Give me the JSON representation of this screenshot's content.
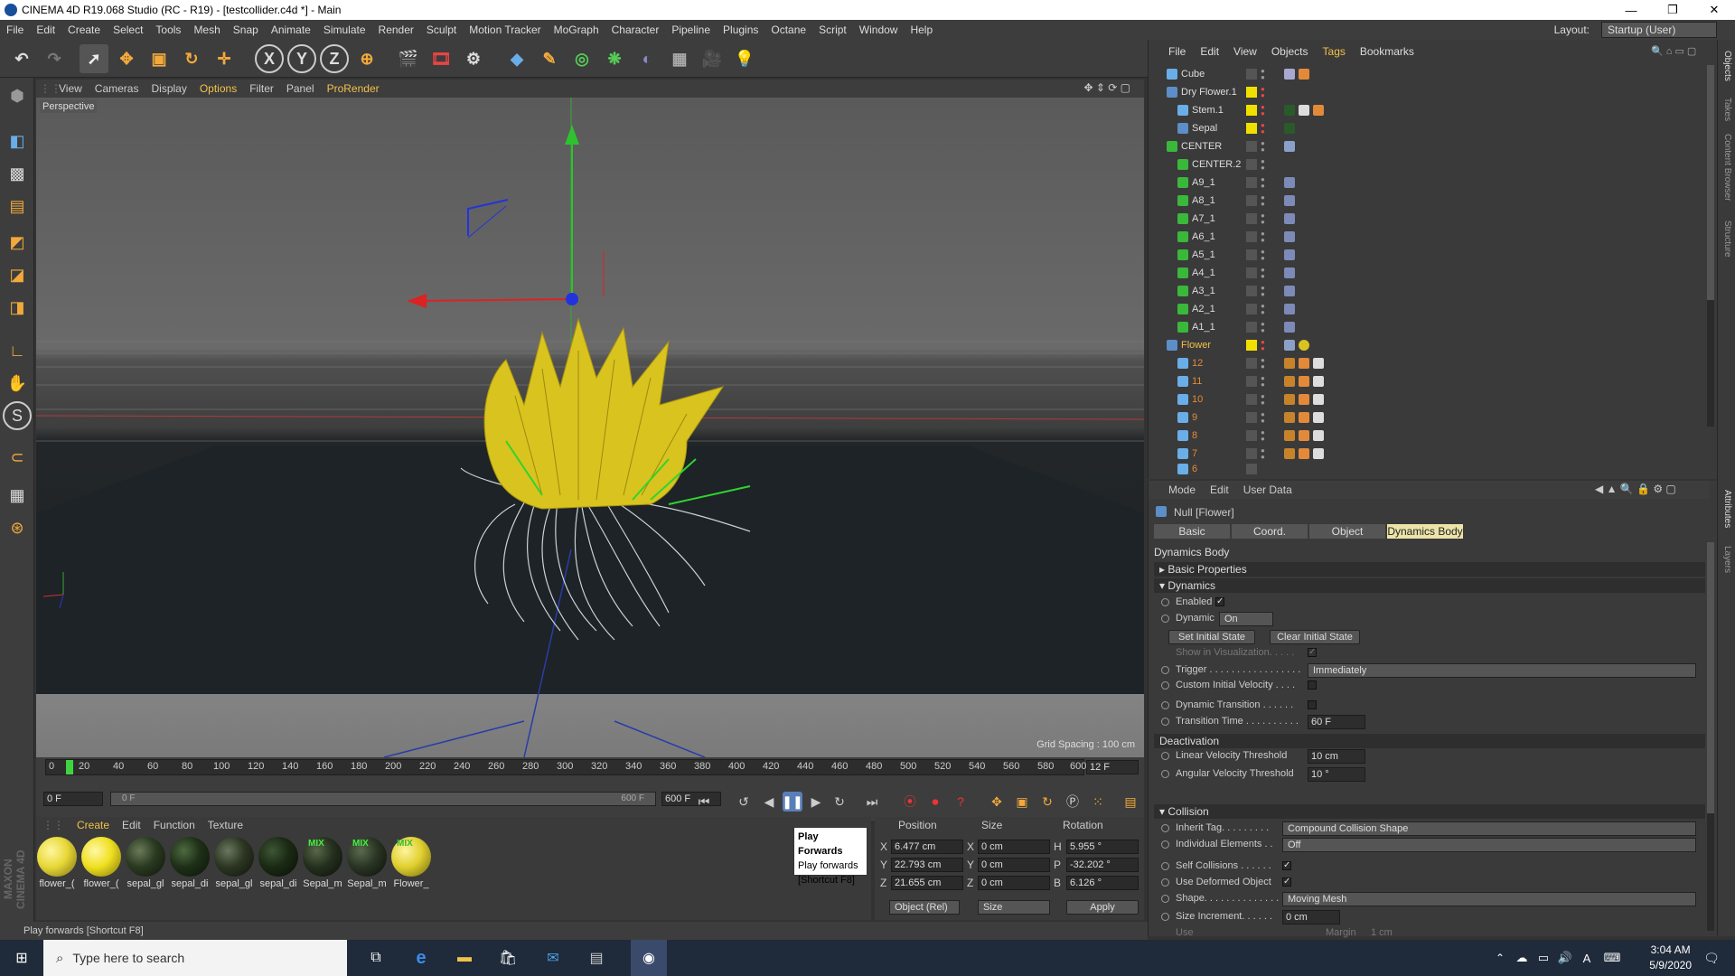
{
  "window": {
    "title": "CINEMA 4D R19.068 Studio (RC - R19) - [testcollider.c4d *] - Main",
    "min": "—",
    "max": "❐",
    "close": "✕"
  },
  "menu": [
    "File",
    "Edit",
    "Create",
    "Select",
    "Tools",
    "Mesh",
    "Snap",
    "Animate",
    "Simulate",
    "Render",
    "Sculpt",
    "Motion Tracker",
    "MoGraph",
    "Character",
    "Pipeline",
    "Plugins",
    "Octane",
    "Script",
    "Window",
    "Help"
  ],
  "layout": {
    "label": "Layout:",
    "value": "Startup (User)"
  },
  "viewport": {
    "menu": [
      "View",
      "Cameras",
      "Display",
      "Options",
      "Filter",
      "Panel",
      "ProRender"
    ],
    "label": "Perspective",
    "grid_spacing": "Grid Spacing : 100 cm"
  },
  "timeline": {
    "ticks": [
      "0",
      "20",
      "40",
      "60",
      "80",
      "100",
      "120",
      "140",
      "160",
      "180",
      "200",
      "220",
      "240",
      "260",
      "280",
      "300",
      "320",
      "340",
      "360",
      "380",
      "400",
      "420",
      "440",
      "460",
      "480",
      "500",
      "520",
      "540",
      "560",
      "580",
      "600"
    ],
    "current": "12 F",
    "start": "0 F",
    "range_start": "0 F",
    "range_end": "600 F",
    "end": "600 F"
  },
  "materials": {
    "menu": [
      "Create",
      "Edit",
      "Function",
      "Texture"
    ],
    "items": [
      {
        "name": "flower_(",
        "color": "#e8d838"
      },
      {
        "name": "flower_(",
        "color": "#f0e020"
      },
      {
        "name": "sepal_gl",
        "color": "#2a3a20"
      },
      {
        "name": "sepal_di",
        "color": "#1e3018"
      },
      {
        "name": "sepal_gl",
        "color": "#2c3622"
      },
      {
        "name": "sepal_di",
        "color": "#1a2a14"
      },
      {
        "name": "Sepal_m",
        "color": "#25301e",
        "mix": "MIX"
      },
      {
        "name": "Sepal_m",
        "color": "#2a3524",
        "mix": "MIX"
      },
      {
        "name": "Flower_",
        "color": "#e0d030",
        "mix": "MIX"
      }
    ]
  },
  "coords": {
    "headers": [
      "Position",
      "Size",
      "Rotation"
    ],
    "rows": [
      {
        "a": "X",
        "pos": "6.477 cm",
        "b": "X",
        "size": "0 cm",
        "c": "H",
        "rot": "5.955 °"
      },
      {
        "a": "Y",
        "pos": "22.793 cm",
        "b": "Y",
        "size": "0 cm",
        "c": "P",
        "rot": "-32.202 °"
      },
      {
        "a": "Z",
        "pos": "21.655 cm",
        "b": "Z",
        "size": "0 cm",
        "c": "B",
        "rot": "6.126 °"
      }
    ],
    "mode": "Object (Rel)",
    "size_mode": "Size",
    "apply": "Apply"
  },
  "tooltip": [
    "Play Forwards",
    "Play forwards",
    "[Shortcut F8]"
  ],
  "status": "Play forwards [Shortcut F8]",
  "objects": {
    "menu": [
      "File",
      "Edit",
      "View",
      "Objects",
      "Tags",
      "Bookmarks"
    ],
    "rows": [
      {
        "name": "Cube",
        "indent": 0
      },
      {
        "name": "Dry Flower.1",
        "indent": 0
      },
      {
        "name": "Stem.1",
        "indent": 1
      },
      {
        "name": "Sepal",
        "indent": 1
      },
      {
        "name": "CENTER",
        "indent": 0
      },
      {
        "name": "CENTER.2",
        "indent": 1
      },
      {
        "name": "A9_1",
        "indent": 1
      },
      {
        "name": "A8_1",
        "indent": 1
      },
      {
        "name": "A7_1",
        "indent": 1
      },
      {
        "name": "A6_1",
        "indent": 1
      },
      {
        "name": "A5_1",
        "indent": 1
      },
      {
        "name": "A4_1",
        "indent": 1
      },
      {
        "name": "A3_1",
        "indent": 1
      },
      {
        "name": "A2_1",
        "indent": 1
      },
      {
        "name": "A1_1",
        "indent": 1
      },
      {
        "name": "Flower",
        "indent": 0
      },
      {
        "name": "12",
        "indent": 1
      },
      {
        "name": "11",
        "indent": 1
      },
      {
        "name": "10",
        "indent": 1
      },
      {
        "name": "9",
        "indent": 1
      },
      {
        "name": "8",
        "indent": 1
      },
      {
        "name": "7",
        "indent": 1
      },
      {
        "name": "6",
        "indent": 1
      }
    ]
  },
  "attributes": {
    "menu": [
      "Mode",
      "Edit",
      "User Data"
    ],
    "object": "Null [Flower]",
    "tabs": [
      "Basic",
      "Coord.",
      "Object",
      "Dynamics Body"
    ],
    "heading": "Dynamics Body",
    "basic_props": "Basic Properties",
    "dynamics": "Dynamics",
    "enabled": "Enabled",
    "dynamic": "Dynamic",
    "dynamic_value": "On",
    "set_initial": "Set Initial State",
    "clear_initial": "Clear Initial State",
    "show_vis": "Show in Visualization. . . . .",
    "trigger": "Trigger . . . . . . . . . . . . . . . . .",
    "trigger_value": "Immediately",
    "custom_vel": "Custom Initial Velocity . . . .",
    "dyn_trans": "Dynamic Transition . . . . . .",
    "trans_time": "Transition Time . . . . . . . . . .",
    "trans_time_value": "60 F",
    "deactivation": "Deactivation",
    "lin_vel": "Linear Velocity Threshold",
    "lin_vel_value": "10 cm",
    "ang_vel": "Angular Velocity Threshold",
    "ang_vel_value": "10 °",
    "collision": "Collision",
    "inherit": "Inherit Tag. . . . . . . . .",
    "inherit_value": "Compound Collision Shape",
    "indiv": "Individual Elements . .",
    "indiv_value": "Off",
    "self_col": "Self Collisions . . . . . .",
    "deformed": "Use Deformed Object",
    "shape": "Shape. . . . . . . . . . . . . .",
    "shape_value": "Moving Mesh",
    "size_inc": "Size Increment. . . . . .",
    "size_inc_value": "0 cm",
    "use": "Use",
    "margin": "Margin",
    "margin_value": "1 cm"
  },
  "right_tabs": [
    "Objects",
    "Takes",
    "Content Browser",
    "Structure",
    "Attributes",
    "Layers"
  ],
  "taskbar": {
    "search": "Type here to search",
    "time": "3:04 AM",
    "date": "5/9/2020"
  }
}
